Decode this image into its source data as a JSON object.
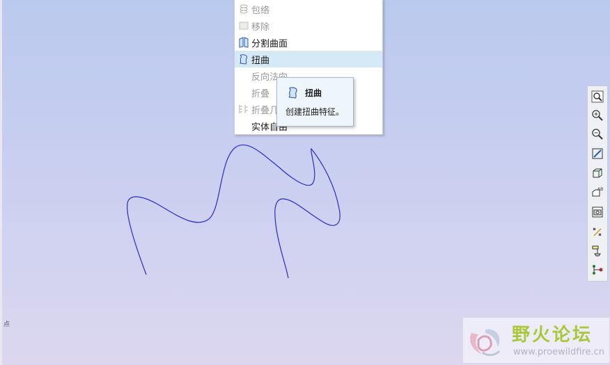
{
  "context_menu": {
    "items": [
      {
        "label": "包络",
        "icon": "wrap-icon",
        "state": "disabled"
      },
      {
        "label": "移除",
        "icon": "remove-icon",
        "state": "disabled"
      },
      {
        "label": "分割曲面",
        "icon": "split-surface-icon",
        "state": "enabled"
      },
      {
        "label": "扭曲",
        "icon": "warp-icon",
        "state": "highlighted"
      },
      {
        "label": "反向法向",
        "icon": "",
        "state": "disabled"
      },
      {
        "label": "折叠",
        "icon": "",
        "state": "disabled"
      },
      {
        "label": "折叠几",
        "icon": "fold-geometry-icon",
        "state": "disabled"
      },
      {
        "label": "实体自由",
        "icon": "",
        "state": "enabled"
      }
    ]
  },
  "tooltip": {
    "title": "扭曲",
    "description": "创建扭曲特征。",
    "icon": "warp-icon"
  },
  "toolbar": {
    "buttons": [
      {
        "name": "refit-icon"
      },
      {
        "name": "zoom-in-icon"
      },
      {
        "name": "zoom-out-icon"
      },
      {
        "name": "repaint-icon"
      },
      {
        "name": "saved-views-icon"
      },
      {
        "name": "view-manager-icon"
      },
      {
        "name": "snapshot-icon"
      },
      {
        "name": "datum-display-icon"
      },
      {
        "name": "spin-center-icon"
      },
      {
        "name": "annotation-display-icon"
      }
    ]
  },
  "status": {
    "text": "点"
  },
  "watermark": {
    "title": "野火论坛",
    "url": "www.proewildfire.cn"
  },
  "colors": {
    "curve": "#2a2ac8",
    "menu_highlight": "#d5e9f7",
    "tooltip_bg": "#eef6fc",
    "watermark_green": "#a9c83a"
  }
}
